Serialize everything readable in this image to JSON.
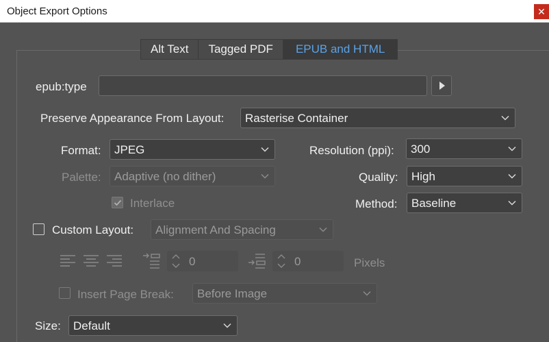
{
  "window": {
    "title": "Object Export Options",
    "close_glyph": "✕"
  },
  "tabs": [
    {
      "label": "Alt Text",
      "active": false
    },
    {
      "label": "Tagged PDF",
      "active": false
    },
    {
      "label": "EPUB and HTML",
      "active": true
    }
  ],
  "epub_type": {
    "label": "epub:type",
    "value": ""
  },
  "preserve": {
    "label": "Preserve Appearance From Layout:",
    "value": "Rasterise Container"
  },
  "format": {
    "label": "Format:",
    "value": "JPEG"
  },
  "resolution": {
    "label": "Resolution (ppi):",
    "value": "300"
  },
  "palette": {
    "label": "Palette:",
    "value": "Adaptive (no dither)",
    "enabled": false
  },
  "quality": {
    "label": "Quality:",
    "value": "High"
  },
  "interlace": {
    "label": "Interlace",
    "checked": true,
    "enabled": false
  },
  "method": {
    "label": "Method:",
    "value": "Baseline"
  },
  "custom_layout": {
    "label": "Custom Layout:",
    "checked": false,
    "value": "Alignment And Spacing",
    "enabled": false
  },
  "spacing": {
    "before_value": "0",
    "after_value": "0",
    "unit": "Pixels"
  },
  "page_break": {
    "label": "Insert Page Break:",
    "checked": false,
    "value": "Before Image",
    "enabled": false
  },
  "size": {
    "label": "Size:",
    "value": "Default"
  },
  "colors": {
    "accent": "#5aa2e8",
    "background": "#535353",
    "close": "#c42b1c"
  }
}
